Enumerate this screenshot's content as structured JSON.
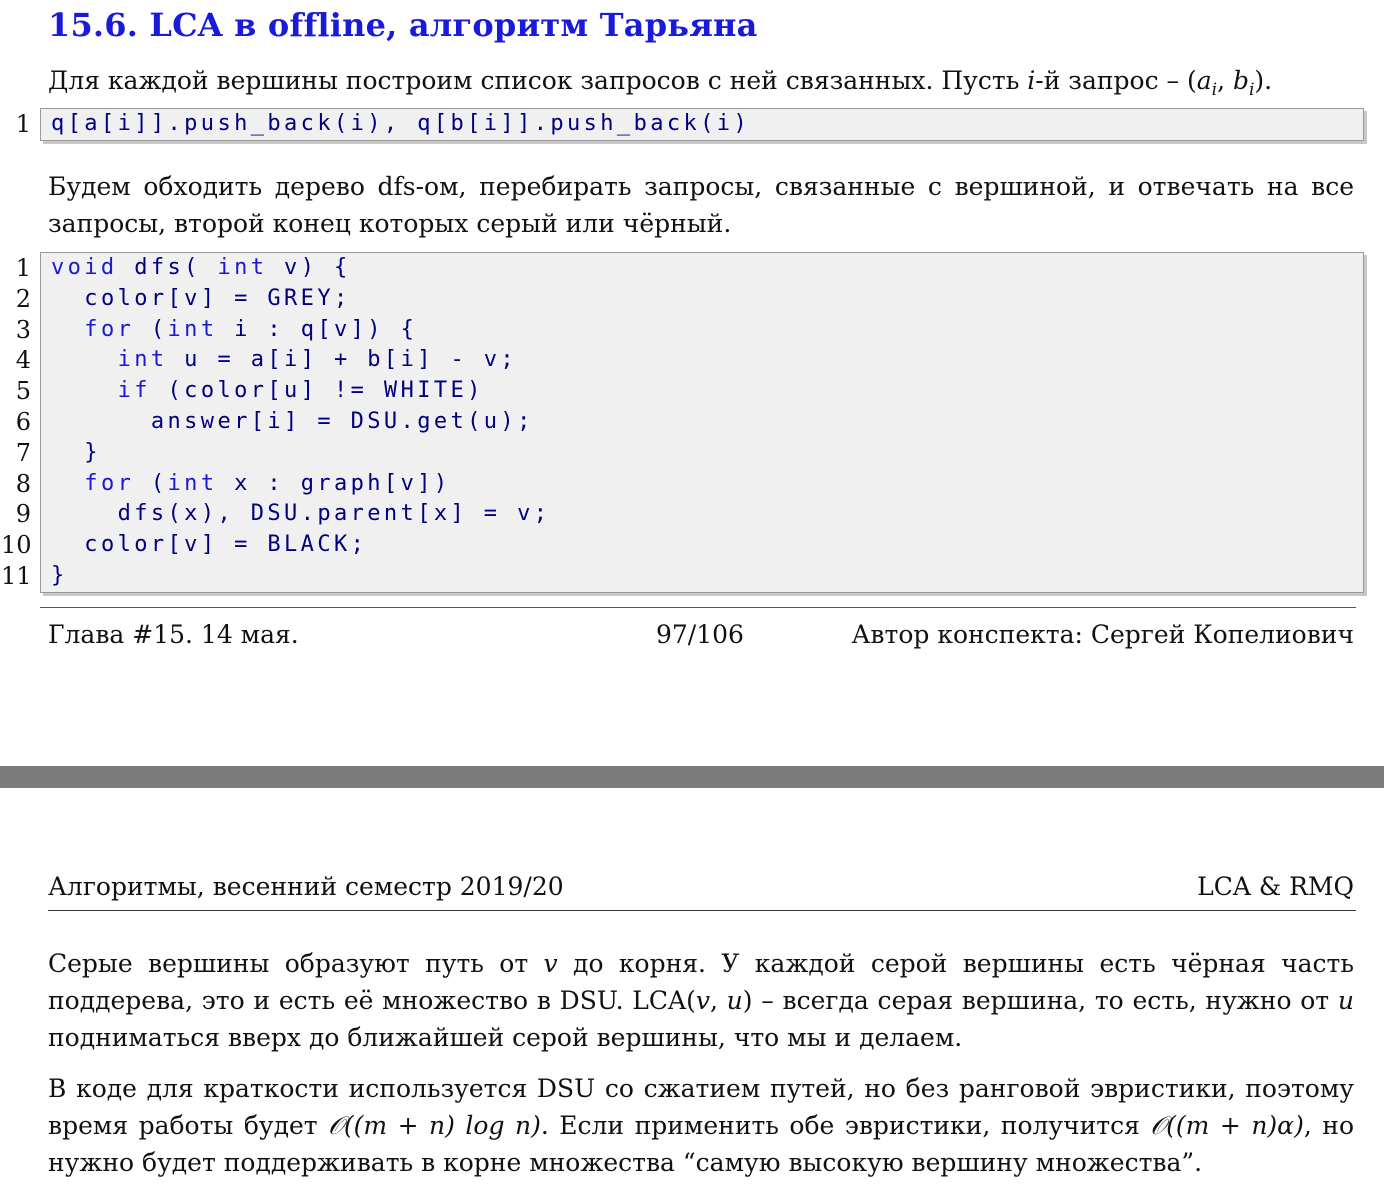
{
  "page_top": {
    "section_title": "15.6. LCA в offline, алгоритм Тарьяна",
    "intro": {
      "text": "Для каждой вершины построим список запросов с ней связанных. Пусть ",
      "var_i": "i",
      "text2": "-й запрос – (",
      "var_a": "a",
      "sub_i1": "i",
      "comma": ", ",
      "var_b": "b",
      "sub_i2": "i",
      "text3": ")."
    },
    "code1": {
      "lines": [
        {
          "no": "1",
          "code": "q[a[i]].push_back(i), q[b[i]].push_back(i)"
        }
      ]
    },
    "para2": "Будем обходить дерево dfs-ом, перебирать запросы, связанные с вершиной, и отвечать на все запросы, второй конец которых серый или чёрный.",
    "code2": {
      "lines": [
        {
          "no": "1",
          "indent": "",
          "kw": "void",
          "rest": " dfs( ",
          "kw2": "int",
          "rest2": " v) {"
        },
        {
          "no": "2",
          "indent": "  ",
          "kw": "",
          "rest": "color[v] = GREY;",
          "kw2": "",
          "rest2": ""
        },
        {
          "no": "3",
          "indent": "  ",
          "kw": "for",
          "rest": " (",
          "kw2": "int",
          "rest2": " i : q[v]) {"
        },
        {
          "no": "4",
          "indent": "    ",
          "kw": "int",
          "rest": " u = a[i] + b[i] - v;",
          "kw2": "",
          "rest2": ""
        },
        {
          "no": "5",
          "indent": "    ",
          "kw": "if",
          "rest": " (color[u] != WHITE)",
          "kw2": "",
          "rest2": ""
        },
        {
          "no": "6",
          "indent": "      ",
          "kw": "",
          "rest": "answer[i] = DSU.get(u);",
          "kw2": "",
          "rest2": ""
        },
        {
          "no": "7",
          "indent": "  ",
          "kw": "",
          "rest": "}",
          "kw2": "",
          "rest2": ""
        },
        {
          "no": "8",
          "indent": "  ",
          "kw": "for",
          "rest": " (",
          "kw2": "int",
          "rest2": " x : graph[v])"
        },
        {
          "no": "9",
          "indent": "    ",
          "kw": "",
          "rest": "dfs(x), DSU.parent[x] = v;",
          "kw2": "",
          "rest2": ""
        },
        {
          "no": "10",
          "indent": "  ",
          "kw": "",
          "rest": "color[v] = BLACK;",
          "kw2": "",
          "rest2": ""
        },
        {
          "no": "11",
          "indent": "",
          "kw": "",
          "rest": "}",
          "kw2": "",
          "rest2": ""
        }
      ]
    },
    "footer": {
      "chapter": "Глава #15. 14 мая.",
      "page_number": "97/106",
      "author": "Автор конспекта: Сергей Копелиович"
    }
  },
  "page_bottom": {
    "header": {
      "course": "Алгоритмы, весенний семестр 2019/20",
      "topic": "LCA & RMQ"
    },
    "para1": {
      "t1": "Серые вершины образуют путь от ",
      "v": "v",
      "t2": " до корня. У каждой серой вершины есть чёрная часть поддерева, это и есть её множество в DSU. LCA(",
      "v2": "v",
      "comma": ", ",
      "u": "u",
      "t3": ") – всегда серая вершина, то есть, нужно от ",
      "u2": "u",
      "t4": " подниматься вверх до ближайшей серой вершины, что мы и делаем."
    },
    "para2": {
      "t1": "В коде для краткости используется DSU со сжатием путей, но без ранговой эвристики, поэтому время работы будет ",
      "f1": "𝒪((m + n) log n)",
      "t2": ". Если применить обе эвристики, получится ",
      "f2": "𝒪((m + n)α)",
      "t3": ", но нужно будет поддерживать в корне множества “самую высокую вершину множества”."
    }
  }
}
